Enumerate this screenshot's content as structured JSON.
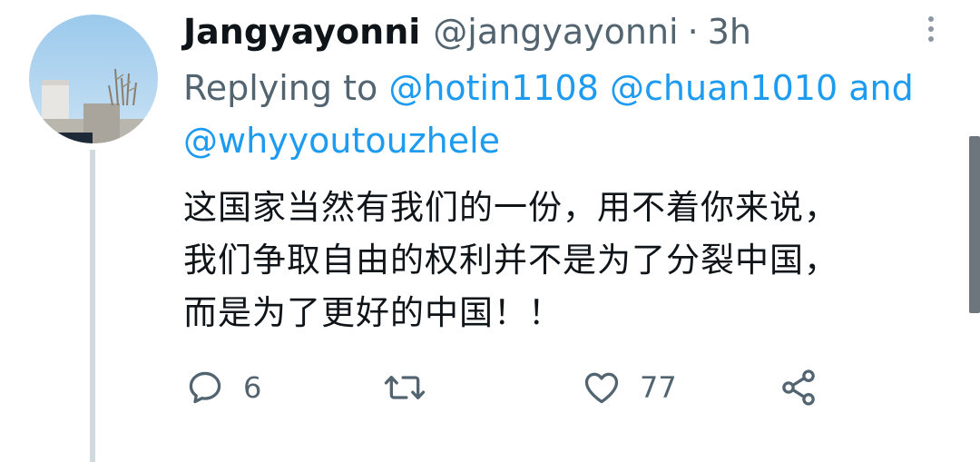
{
  "tweet": {
    "display_name": "Jangyayonni",
    "handle": "@jangyayonni",
    "separator": "·",
    "time": "3h",
    "replying_prefix": "Replying to",
    "mention_1": "@hotin1108",
    "mention_2": "@chuan1010",
    "mention_joiner": "and",
    "mention_3": "@whyyoutouzhele",
    "text_lines": [
      "这国家当然有我们的一份，用不着你来说，",
      "我们争取自由的权利并不是为了分裂中国，",
      "而是为了更好的中国！！"
    ]
  },
  "actions": {
    "reply_icon": "reply-icon",
    "reply_count": "6",
    "retweet_icon": "retweet-icon",
    "like_icon": "heart-icon",
    "like_count": "77",
    "share_icon": "share-icon"
  },
  "colors": {
    "link": "#1d9bf0",
    "secondary_text": "#536471",
    "primary_text": "#0f1419",
    "thread_line": "#cfd9de"
  }
}
